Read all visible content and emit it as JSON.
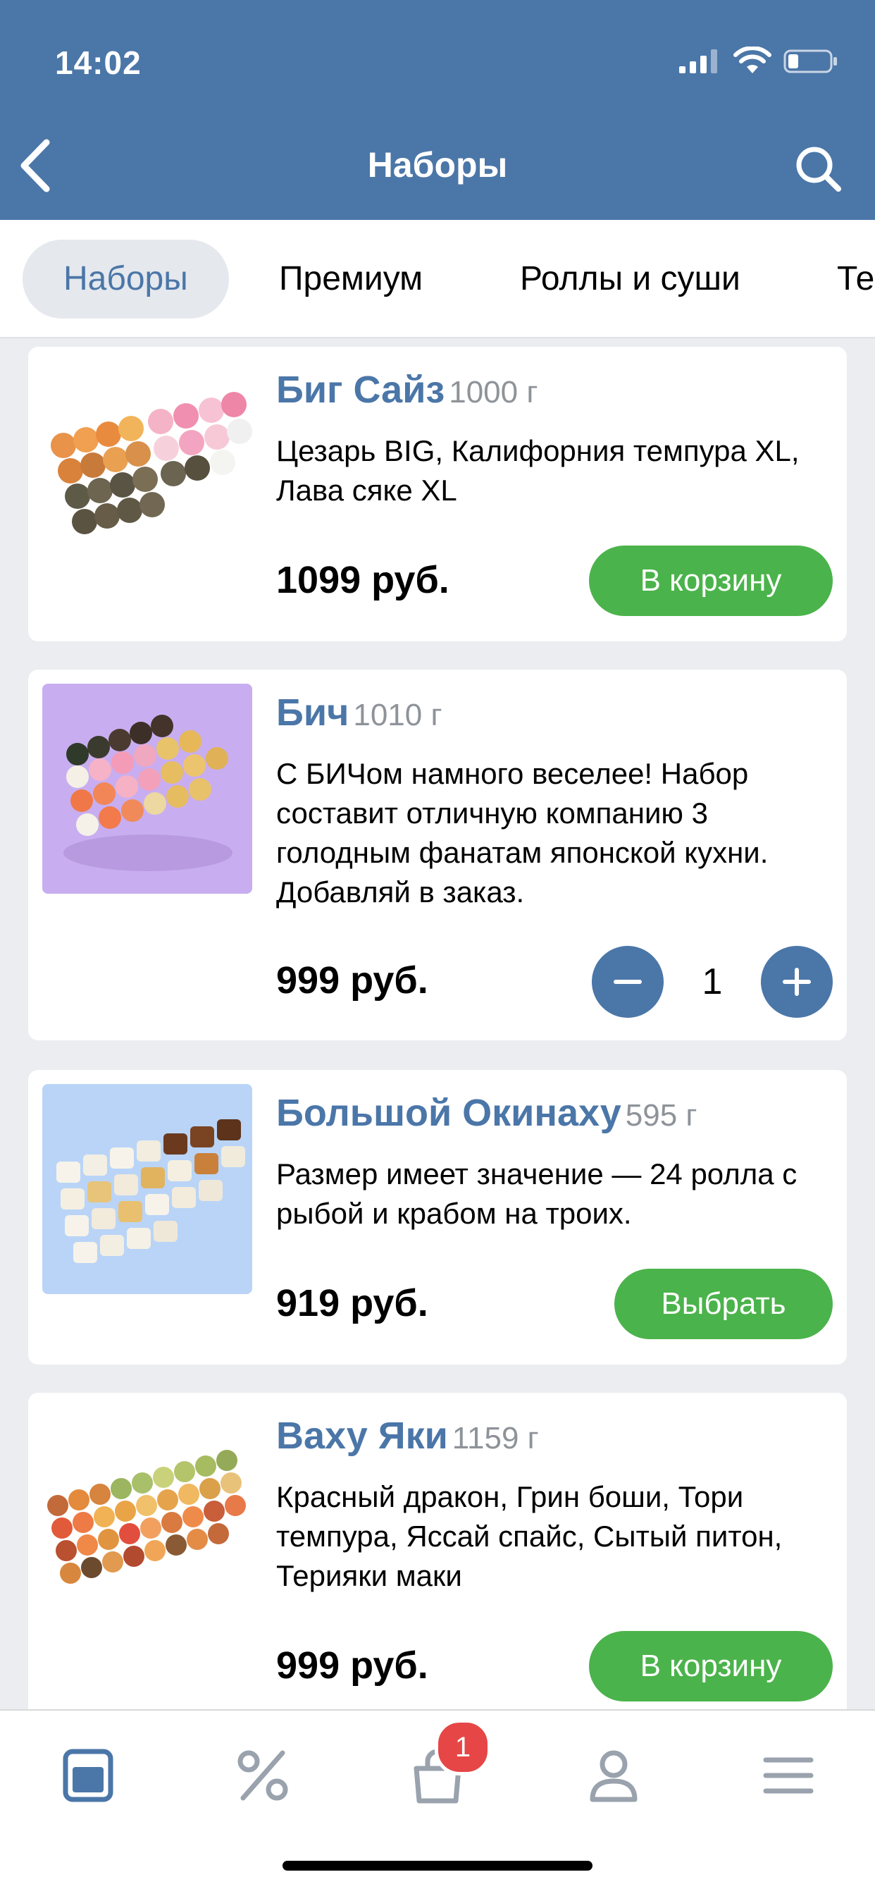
{
  "status_bar": {
    "time": "14:02"
  },
  "header": {
    "title": "Наборы"
  },
  "tabs": [
    {
      "label": "Наборы",
      "active": true
    },
    {
      "label": "Премиум",
      "active": false
    },
    {
      "label": "Роллы и суши",
      "active": false
    },
    {
      "label": "Те",
      "active": false
    }
  ],
  "products": [
    {
      "name": "Биг Сайз",
      "weight": "1000 г",
      "description": "Цезарь BIG, Калифорния темпура XL, Лава сяке XL",
      "price": "1099 руб.",
      "action_label": "В корзину",
      "image_bg": "#ffffff"
    },
    {
      "name": "Бич",
      "weight": "1010 г",
      "description": "С БИЧом намного веселее! Набор составит отличную компанию 3 голодным фанатам японской кухни. Добавляй в заказ.",
      "price": "999 руб.",
      "quantity": "1",
      "image_bg": "#c8aef0"
    },
    {
      "name": "Большой Окинаху",
      "weight": "595 г",
      "description": "Размер имеет значение — 24 ролла с рыбой и крабом на троих.",
      "price": "919 руб.",
      "action_label": "Выбрать",
      "image_bg": "#b9d4f7"
    },
    {
      "name": "Ваху Яки",
      "weight": "1159 г",
      "description": "Красный дракон, Грин боши, Тори темпура, Яссай спайс, Сытый питон, Терияки маки",
      "price": "999 руб.",
      "action_label": "В корзину",
      "image_bg": "#ffffff"
    }
  ],
  "bottom_nav": {
    "items": [
      "catalog-icon",
      "percent-icon",
      "cart-icon",
      "profile-icon",
      "menu-icon"
    ],
    "cart_badge": "1"
  },
  "colors": {
    "accent": "#4b76a8",
    "green": "#4bb34b",
    "badge": "#e64646",
    "background": "#ebedf0"
  }
}
